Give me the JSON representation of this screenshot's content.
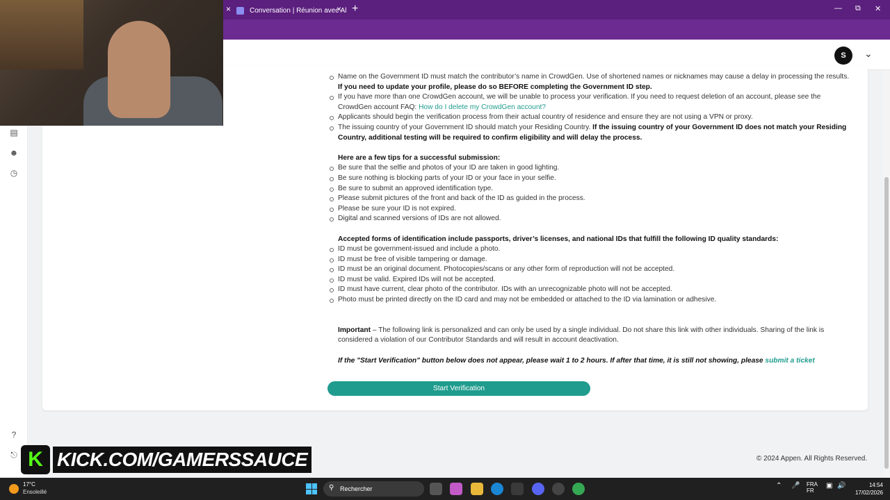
{
  "browser": {
    "tab_title": "Conversation | Réunion avec Al",
    "close_glyph": "×",
    "new_tab_glyph": "+",
    "url_fragment": "2"
  },
  "header": {
    "avatar_initial": "S"
  },
  "content": {
    "bullets_top": [
      {
        "text": "Name on the Government ID must match the contributor’s name in CrowdGen. Use of shortened names or nicknames may cause a delay in processing the results. ",
        "bold": "If you need to update your profile, please do so BEFORE completing the Government ID step."
      },
      {
        "text": "If you have more than one CrowdGen account, we will be unable to process your verification. If you need to request deletion of an account, please see the CrowdGen account FAQ: ",
        "link": "How do I delete my CrowdGen account?"
      },
      {
        "text": "Applicants should begin the verification process from their actual country of residence and ensure they are not using a VPN or proxy."
      },
      {
        "text": "The issuing country of your Government ID should match your Residing Country. ",
        "bold": "If the issuing country of your Government ID does not match your Residing Country, additional testing will be required to confirm eligibility and will delay the process."
      }
    ],
    "tips_heading": "Here are a few tips for a successful submission:",
    "tips": [
      "Be sure that the selfie and photos of your ID are taken in good lighting.",
      "Be sure nothing is blocking parts of your ID or your face in your selfie.",
      "Be sure to submit an approved identification type.",
      "Please submit pictures of the front and back of the ID as guided in the process.",
      "Please be sure your ID is not expired.",
      "Digital and scanned versions of IDs are not allowed."
    ],
    "accepted_heading": "Accepted forms of identification include passports, driver’s licenses, and national IDs that fulfill the following ID quality standards:",
    "accepted": [
      "ID must be government-issued and include a photo.",
      "ID must be free of visible tampering or damage.",
      "ID must be an original document. Photocopies/scans or any other form of reproduction will not be accepted.",
      "ID must be valid. Expired IDs will not be accepted.",
      "ID must have current, clear photo of the contributor. IDs with an unrecognizable photo will not be accepted.",
      "Photo must be printed directly on the ID card and may not be embedded or attached to the ID via lamination or adhesive."
    ],
    "important_label": "Important",
    "important_text": " – The following link is personalized and can only be used by a single individual. Do not share this link with other individuals. Sharing of the link is considered a violation of our Contributor Standards and will result in account deactivation.",
    "wait_note": "If the \"Start Verification\" button below does not appear, please wait 1 to 2 hours. If after that time, it is still not showing, please ",
    "ticket_link": "submit a ticket",
    "verify_button": "Start Verification"
  },
  "footer": {
    "copyright": "© 2024 Appen. All Rights Reserved."
  },
  "overlay": {
    "kick_logo": "K",
    "kick_text": "KICK.COM/GAMERSSAUCE"
  },
  "taskbar": {
    "temperature": "17°C",
    "weather": "Ensoleillé",
    "search_placeholder": "Rechercher",
    "lang_top": "FRA",
    "lang_bottom": "FR",
    "time": "14:54",
    "date": "17/02/2026"
  },
  "colors": {
    "accent": "#1f9c8e",
    "browser_frame": "#5b1f7e"
  }
}
